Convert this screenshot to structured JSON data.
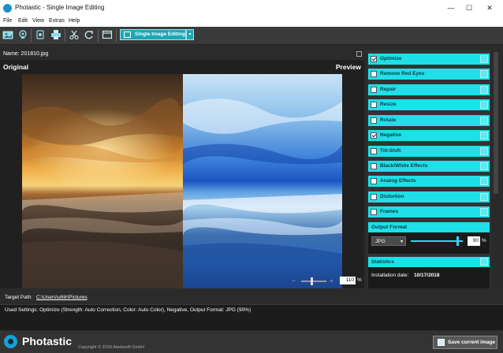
{
  "window": {
    "title": "Photastic - Single Image Editing"
  },
  "menu": [
    "File",
    "Edit",
    "View",
    "Extras",
    "Help"
  ],
  "toolbar": {
    "mode_label": "Single Image Editing"
  },
  "image": {
    "name_label": "Name: 201810.jpg"
  },
  "viewer": {
    "original_label": "Original",
    "preview_label": "Preview",
    "zoom_value": "110",
    "zoom_unit": "%"
  },
  "options": [
    {
      "label": "Optimize",
      "checked": true
    },
    {
      "label": "Remove Red Eyes",
      "checked": false
    },
    {
      "label": "Repair",
      "checked": false
    },
    {
      "label": "Resize",
      "checked": false
    },
    {
      "label": "Rotate",
      "checked": false
    },
    {
      "label": "Negative",
      "checked": true
    },
    {
      "label": "Tilt-Shift",
      "checked": false
    },
    {
      "label": "Black/White Effects",
      "checked": false
    },
    {
      "label": "Analog Effects",
      "checked": false
    },
    {
      "label": "Distortion",
      "checked": false
    },
    {
      "label": "Frames",
      "checked": false
    }
  ],
  "output_format": {
    "title": "Output Format",
    "format": "JPG",
    "quality": "90",
    "unit": "%"
  },
  "statistics": {
    "title": "Statistics",
    "installation_label": "Installation date:",
    "installation_date": "10/17/2018"
  },
  "target": {
    "label": "Target Path:",
    "path": "C:\\Users\\uhlir\\Pictures"
  },
  "settings": {
    "text": "Used Settings: Optimize (Strength: Auto Correction, Color: Auto Color), Negative, Output Format: JPG (90%)"
  },
  "footer": {
    "brand": "Photastic",
    "copyright": "Copyright © 2018 Abelssoft GmbH",
    "save_label": "Save current image"
  },
  "colors": {
    "accent": "#1fdfe8",
    "mode_button": "#1ea7b5",
    "background": "#2b2b2b"
  }
}
